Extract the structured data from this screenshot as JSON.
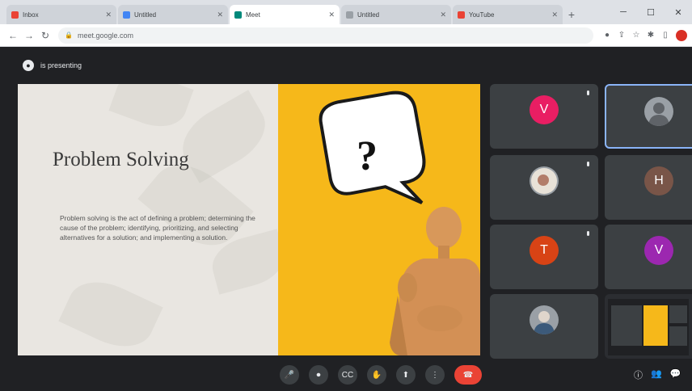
{
  "browser": {
    "tabs": [
      {
        "label": "Inbox",
        "color": "#ea4335",
        "active": false
      },
      {
        "label": "Untitled",
        "color": "#4285f4",
        "active": false
      },
      {
        "label": "Meet",
        "color": "#00897b",
        "active": true
      },
      {
        "label": "Untitled",
        "color": "#9aa0a6",
        "active": false
      },
      {
        "label": "YouTube",
        "color": "#ea4335",
        "active": false
      }
    ],
    "new_tab": "+",
    "url": "meet.google.com",
    "window_controls": {
      "minimize": "─",
      "maximize": "☐",
      "close": "✕"
    }
  },
  "meet": {
    "presenting_text": "is presenting",
    "slide": {
      "title": "Problem Solving",
      "body": "Problem solving is the act of defining a problem; determining the cause of the problem; identifying, prioritizing, and selecting alternatives for a solution; and implementing a solution.",
      "question_mark": "?"
    },
    "participants": [
      {
        "name": "",
        "initial": "V",
        "color": "#e91e63",
        "photo": false
      },
      {
        "name": "",
        "initial": "",
        "color": "#9aa0a6",
        "photo": true
      },
      {
        "name": "",
        "initial": "",
        "color": "#b0a090",
        "photo": true
      },
      {
        "name": "",
        "initial": "H",
        "color": "#795548",
        "photo": false
      },
      {
        "name": "",
        "initial": "T",
        "color": "#d84315",
        "photo": false
      },
      {
        "name": "",
        "initial": "V",
        "color": "#9c27b0",
        "photo": false
      },
      {
        "name": "",
        "initial": "",
        "color": "#6d8fb0",
        "photo": true
      },
      {
        "name": "",
        "initial": "",
        "color": "#f6b81a",
        "photo": true
      }
    ],
    "clock": "",
    "controls": {
      "mic": "🎤",
      "camera": "⏺",
      "captions": "CC",
      "raise_hand": "✋",
      "present": "⬆",
      "more": "⋮",
      "end_call": "☎"
    },
    "right_controls": {
      "info": "ⓘ",
      "people": "👥",
      "chat": "💬"
    }
  }
}
